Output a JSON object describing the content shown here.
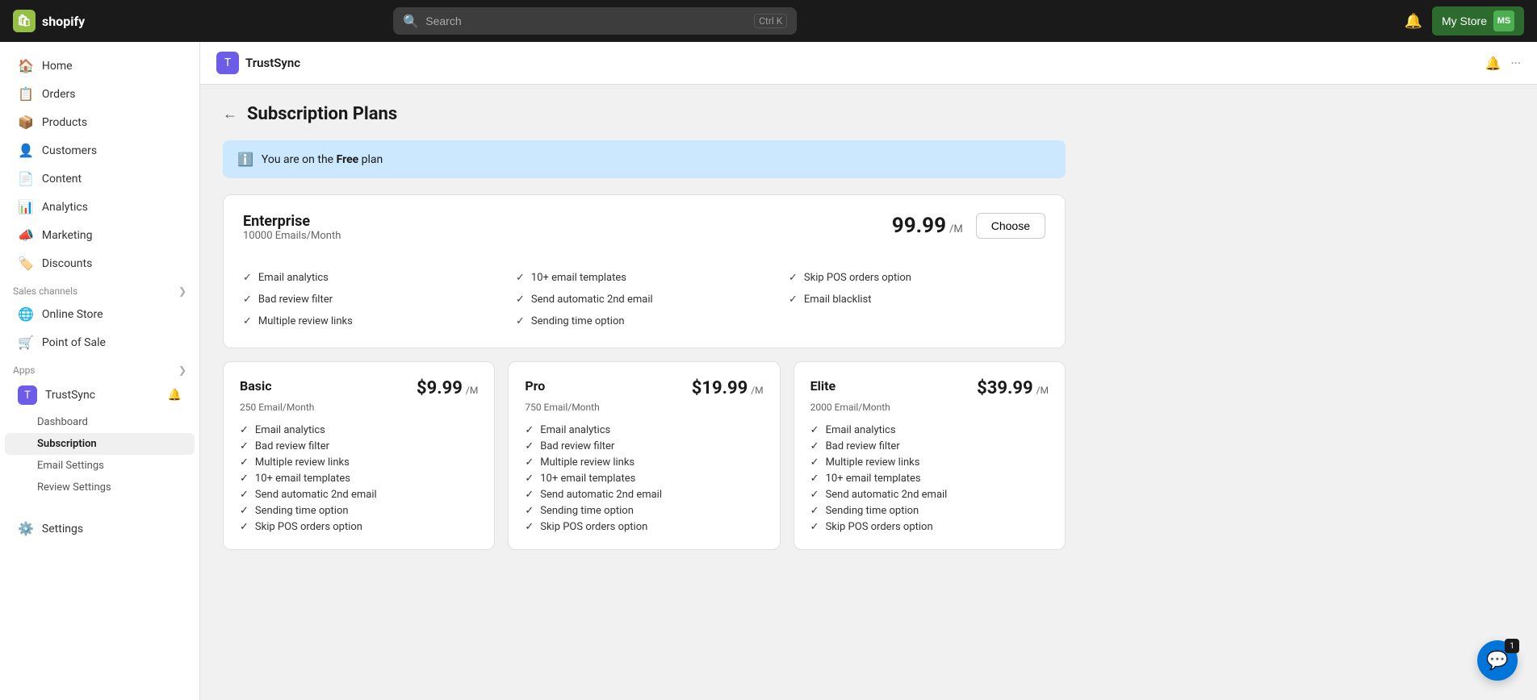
{
  "topnav": {
    "logo_text": "shopify",
    "search_placeholder": "Search",
    "search_shortcut": "Ctrl K",
    "store_name": "My Store",
    "avatar_initials": "MS",
    "notif_icon": "🔔"
  },
  "sidebar": {
    "items": [
      {
        "id": "home",
        "label": "Home",
        "icon": "🏠"
      },
      {
        "id": "orders",
        "label": "Orders",
        "icon": "📋"
      },
      {
        "id": "products",
        "label": "Products",
        "icon": "📦"
      },
      {
        "id": "customers",
        "label": "Customers",
        "icon": "👤"
      },
      {
        "id": "content",
        "label": "Content",
        "icon": "📄"
      },
      {
        "id": "analytics",
        "label": "Analytics",
        "icon": "📊"
      },
      {
        "id": "marketing",
        "label": "Marketing",
        "icon": "📣"
      },
      {
        "id": "discounts",
        "label": "Discounts",
        "icon": "🏷️"
      }
    ],
    "sales_channels_label": "Sales channels",
    "sales_channels": [
      {
        "id": "online-store",
        "label": "Online Store",
        "icon": "🌐"
      },
      {
        "id": "point-of-sale",
        "label": "Point of Sale",
        "icon": "🛒"
      }
    ],
    "apps_label": "Apps",
    "apps": [
      {
        "id": "trustsync",
        "label": "TrustSync",
        "icon": "T"
      }
    ],
    "trustsync_subitems": [
      {
        "id": "dashboard",
        "label": "Dashboard"
      },
      {
        "id": "subscription",
        "label": "Subscription",
        "active": true
      },
      {
        "id": "email-settings",
        "label": "Email Settings"
      },
      {
        "id": "review-settings",
        "label": "Review Settings"
      }
    ],
    "settings_label": "Settings",
    "settings_icon": "⚙️"
  },
  "app_header": {
    "icon": "T",
    "title": "TrustSync",
    "bell_icon": "🔔",
    "more_icon": "···"
  },
  "page": {
    "back_label": "←",
    "title": "Subscription Plans",
    "banner_text": "You are on the ",
    "banner_plan": "Free",
    "banner_suffix": " plan"
  },
  "enterprise_plan": {
    "name": "Enterprise",
    "emails": "10000 Emails/Month",
    "price": "99.99",
    "period": "/M",
    "choose_label": "Choose",
    "features": [
      "Email analytics",
      "10+ email templates",
      "Skip POS orders option",
      "Bad review filter",
      "Send automatic 2nd email",
      "Email blacklist",
      "Multiple review links",
      "Sending time option"
    ]
  },
  "small_plans": [
    {
      "id": "basic",
      "name": "Basic",
      "emails": "250 Email/Month",
      "price": "$9.99",
      "period": "/M",
      "features": [
        "Email analytics",
        "Bad review filter",
        "Multiple review links",
        "10+ email templates",
        "Send automatic 2nd email",
        "Sending time option",
        "Skip POS orders option"
      ]
    },
    {
      "id": "pro",
      "name": "Pro",
      "emails": "750 Email/Month",
      "price": "$19.99",
      "period": "/M",
      "features": [
        "Email analytics",
        "Bad review filter",
        "Multiple review links",
        "10+ email templates",
        "Send automatic 2nd email",
        "Sending time option",
        "Skip POS orders option"
      ]
    },
    {
      "id": "elite",
      "name": "Elite",
      "emails": "2000 Email/Month",
      "price": "$39.99",
      "period": "/M",
      "features": [
        "Email analytics",
        "Bad review filter",
        "Multiple review links",
        "10+ email templates",
        "Send automatic 2nd email",
        "Sending time option",
        "Skip POS orders option"
      ]
    }
  ],
  "chat": {
    "icon": "💬",
    "counter": "1"
  }
}
